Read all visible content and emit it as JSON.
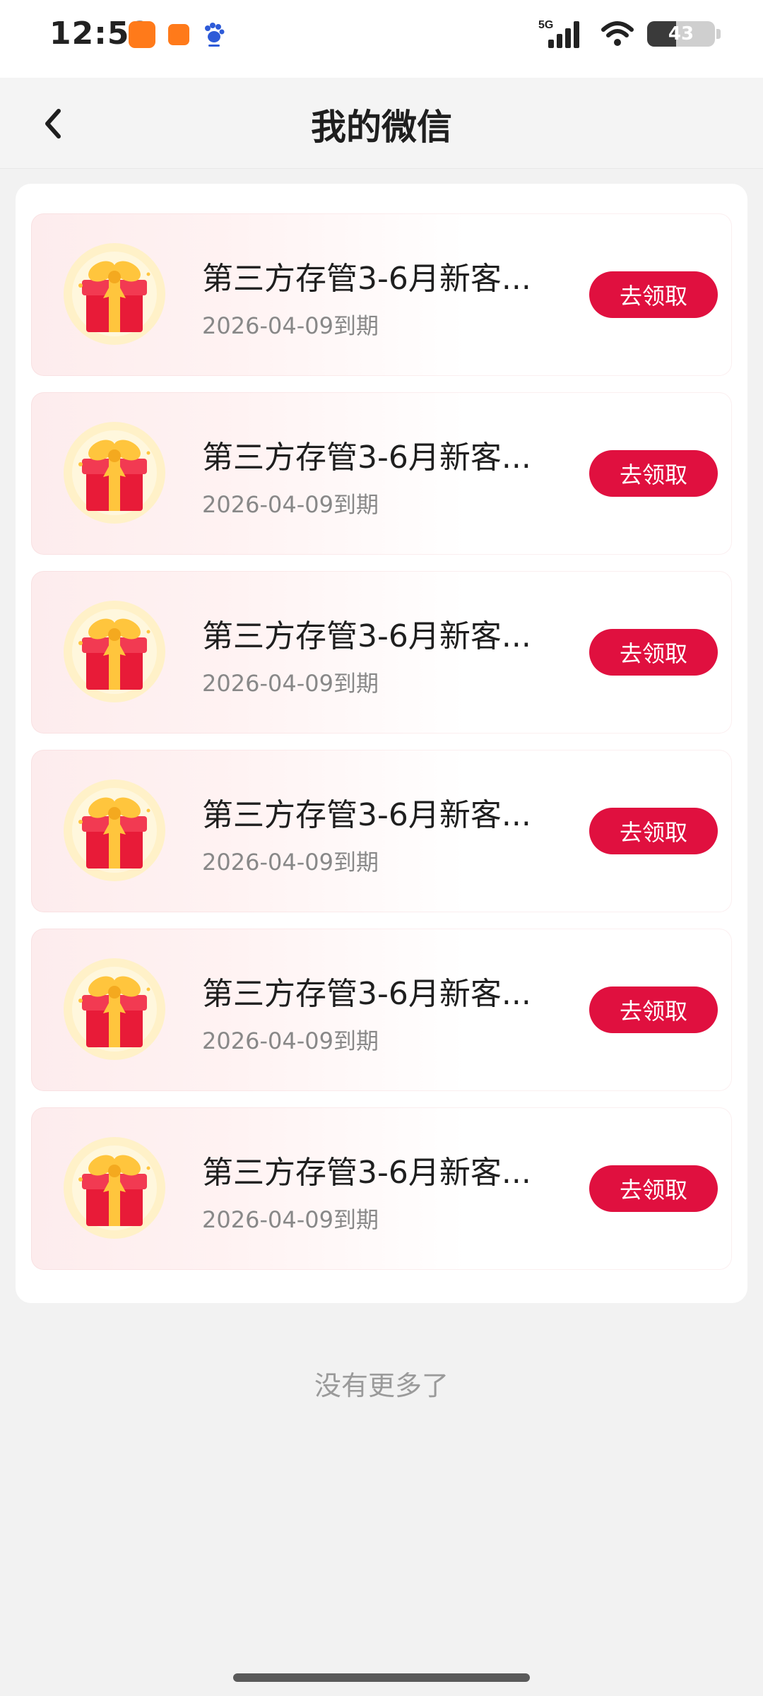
{
  "status_bar": {
    "time": "12:52",
    "network": "5G",
    "battery": "43",
    "battery_level": 0.43,
    "icons": [
      "shopping-app-icon",
      "shopping-app-small-icon",
      "baidu-icon",
      "signal-icon",
      "wifi-icon",
      "battery-icon"
    ]
  },
  "header": {
    "title": "我的微信",
    "back_icon": "chevron-left-icon"
  },
  "list": {
    "items": [
      {
        "title": "第三方存管3-6月新客...",
        "date": "2026-04-09到期",
        "button": "去领取",
        "icon": "gift-icon"
      },
      {
        "title": "第三方存管3-6月新客...",
        "date": "2026-04-09到期",
        "button": "去领取",
        "icon": "gift-icon"
      },
      {
        "title": "第三方存管3-6月新客...",
        "date": "2026-04-09到期",
        "button": "去领取",
        "icon": "gift-icon"
      },
      {
        "title": "第三方存管3-6月新客...",
        "date": "2026-04-09到期",
        "button": "去领取",
        "icon": "gift-icon"
      },
      {
        "title": "第三方存管3-6月新客...",
        "date": "2026-04-09到期",
        "button": "去领取",
        "icon": "gift-icon"
      },
      {
        "title": "第三方存管3-6月新客...",
        "date": "2026-04-09到期",
        "button": "去领取",
        "icon": "gift-icon"
      }
    ]
  },
  "footer": {
    "no_more": "没有更多了"
  },
  "colors": {
    "accent": "#e0103f",
    "background": "#f2f2f2",
    "card": "#ffffff"
  }
}
